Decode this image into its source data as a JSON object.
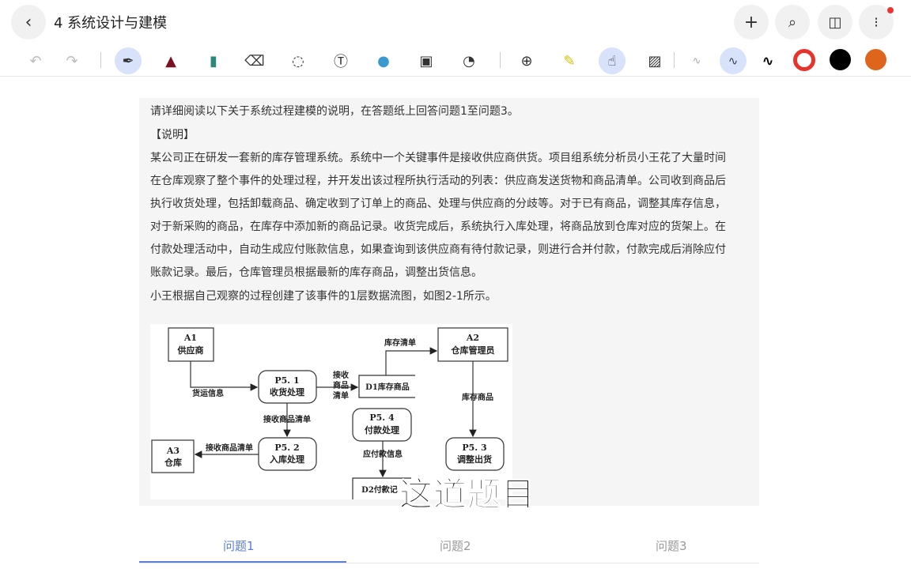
{
  "header": {
    "title": "4 系统设计与建模"
  },
  "toolbar": {
    "icons": [
      "undo-icon",
      "redo-icon",
      "pen-icon",
      "marker-icon",
      "highlighter-icon",
      "eraser-icon",
      "lasso-icon",
      "text-icon",
      "shape-icon",
      "image-icon",
      "sticker-icon",
      "zoom-icon",
      "laser-icon",
      "hand-draw-icon",
      "pattern-icon"
    ],
    "colors": [
      "#e8322c",
      "#000000",
      "#e0651c"
    ],
    "accent": "#d8e2fb"
  },
  "content": {
    "lines": [
      "请详细阅读以下关于系统过程建模的说明，在答题纸上回答问题1至问题3。",
      "【说明】",
      "某公司正在研发一套新的库存管理系统。系统中一个关键事件是接收供应商供货。项目组系统分析员小王花了大量时间",
      "在仓库观察了整个事件的处理过程，并开发出该过程所执行活动的列表：供应商发送货物和商品清单。公司收到商品后",
      "执行收货处理，包括卸载商品、确定收到了订单上的商品、处理与供应商的分歧等。对于已有商品，调整其库存信息，",
      "对于新采购的商品，在库存中添加新的商品记录。收货完成后，系统执行入库处理，将商品放到仓库对应的货架上。在",
      "付款处理活动中，自动生成应付账款信息，如果查询到该供应商有待付款记录，则进行合并付款，付款完成后消除应付",
      "账款记录。最后，仓库管理员根据最新的库存商品，调整出货信息。",
      "小王根据自己观察的过程创建了该事件的1层数据流图，如图2-1所示。"
    ]
  },
  "diagram": {
    "a1_id": "A1",
    "a1_name": "供应商",
    "a2_id": "A2",
    "a2_name": "仓库管理员",
    "a3_id": "A3",
    "a3_name": "仓库",
    "p51_id": "P5. 1",
    "p51_name": "收货处理",
    "p52_id": "P5. 2",
    "p52_name": "入库处理",
    "p53_id": "P5. 3",
    "p53_name": "调整出货",
    "p54_id": "P5. 4",
    "p54_name": "付款处理",
    "d1": "D1库存商品",
    "d2": "D2付款记",
    "f_ship": "货运信息",
    "f_recv1": "接收",
    "f_recv2": "商品",
    "f_recv3": "清单",
    "f_stock_list": "库存清单",
    "f_recv_list": "接收商品清单",
    "f_recv_list2": "接收商品清单",
    "f_stock_goods": "库存商品",
    "f_payable": "应付款信息"
  },
  "subtitle": "这道题目",
  "tabs": [
    "问题1",
    "问题2",
    "问题3"
  ]
}
